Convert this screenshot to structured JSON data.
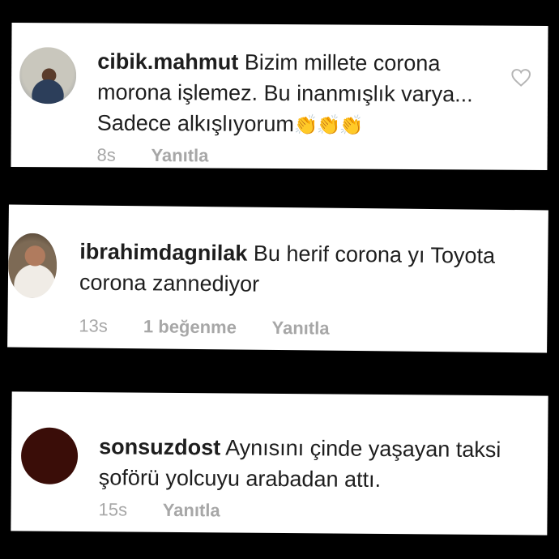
{
  "comments": [
    {
      "username": "cibik.mahmut",
      "text": "Bizim millete corona morona işlemez. Bu inanmışlık varya... Sadece alkışlıyorum",
      "emoji": "👏👏👏",
      "time": "8s",
      "likes": "",
      "reply": "Yanıtla"
    },
    {
      "username": "ibrahimdagnilak",
      "text": "Bu herif corona yı Toyota corona zannediyor",
      "time": "13s",
      "likes": "1 beğenme",
      "reply": "Yanıtla"
    },
    {
      "username": "sonsuzdost",
      "text": "Aynısını çinde yaşayan taksi şoförü  yolcuyu arabadan attı.",
      "time": "15s",
      "likes": "",
      "reply": "Yanıtla"
    }
  ]
}
